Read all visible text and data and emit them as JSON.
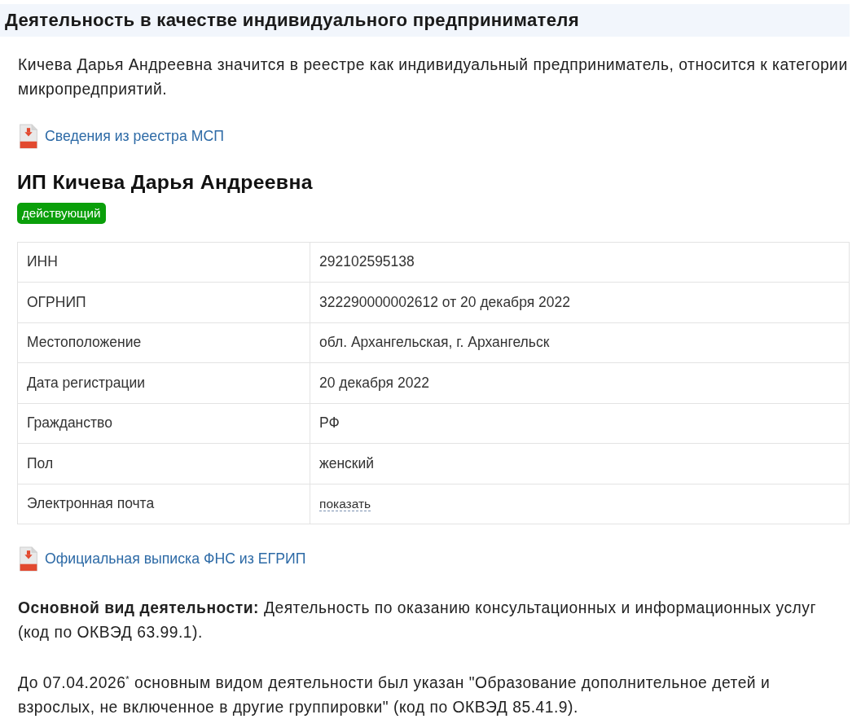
{
  "section": {
    "title": "Деятельность в качестве индивидуального предпринимателя"
  },
  "intro": "Кичева Дарья Андреевна значится в реестре как индивидуальный предприниматель, относится к категории микропредприятий.",
  "msp_link": {
    "label": "Сведения из реестра МСП"
  },
  "entity": {
    "name": "ИП Кичева Дарья Андреевна",
    "status": {
      "label": "действующий",
      "kind": "active"
    }
  },
  "details": {
    "rows": [
      {
        "label": "ИНН",
        "value": "292102595138",
        "kind": "text"
      },
      {
        "label": "ОГРНИП",
        "value": "322290000002612 от 20 декабря 2022",
        "kind": "text"
      },
      {
        "label": "Местоположение",
        "value": "обл. Архангельская, г. Архангельск",
        "kind": "text"
      },
      {
        "label": "Дата регистрации",
        "value": "20 декабря 2022",
        "kind": "text"
      },
      {
        "label": "Гражданство",
        "value": "РФ",
        "kind": "text"
      },
      {
        "label": "Пол",
        "value": "женский",
        "kind": "text"
      },
      {
        "label": "Электронная почта",
        "value": "показать",
        "kind": "reveal"
      }
    ]
  },
  "egrip_link": {
    "label": "Официальная выписка ФНС из ЕГРИП"
  },
  "activity": {
    "main": "**Основной вид деятельности:** Деятельность по оказанию консультационных и информационных услуг (код по ОКВЭД 63.99.1).",
    "previous": "До 07.04.2026$^{*}$ основным видом деятельности был указан \"Образование дополнительное детей и взрослых, не включенное в другие группировки\" (код по ОКВЭД 85.41.9)."
  }
}
